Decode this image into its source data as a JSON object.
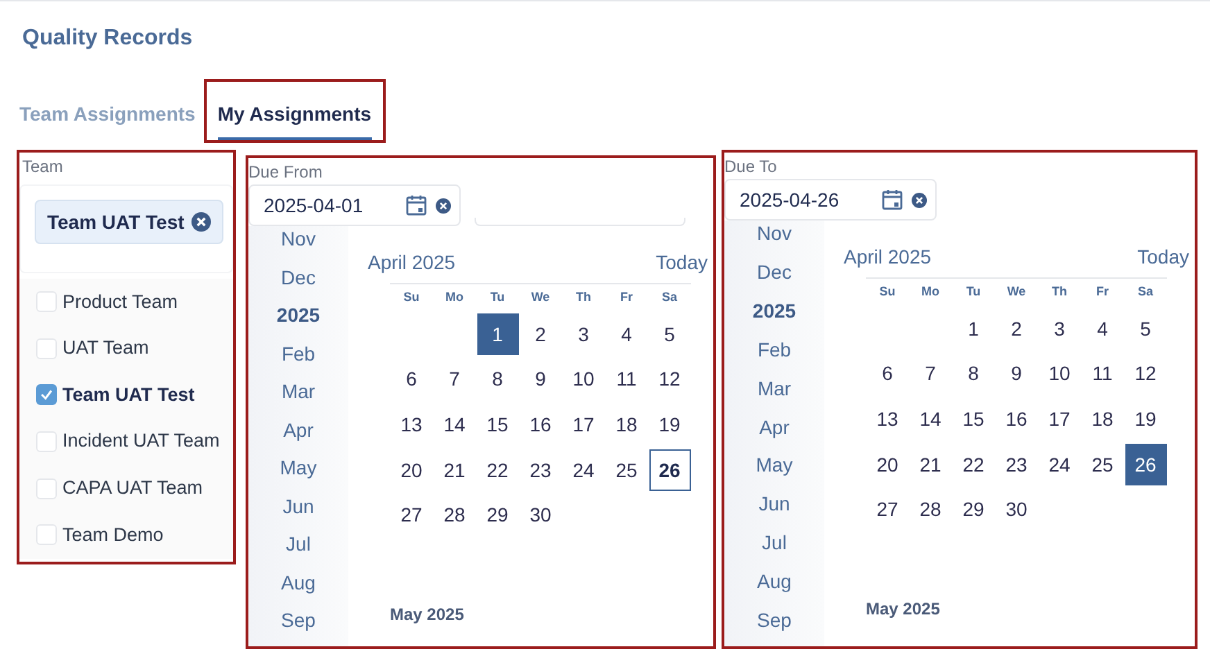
{
  "page_title": "Quality Records",
  "tabs": [
    {
      "label": "Team Assignments",
      "selected": false,
      "highlighted": false
    },
    {
      "label": "My Assignments",
      "selected": true,
      "highlighted": true
    }
  ],
  "team_filter": {
    "label": "Team",
    "highlighted": true,
    "chips": [
      "Team UAT Test"
    ],
    "options": [
      {
        "label": "Product Team",
        "checked": false
      },
      {
        "label": "UAT Team",
        "checked": false
      },
      {
        "label": "Team UAT Test",
        "checked": true
      },
      {
        "label": "Incident UAT Team",
        "checked": false
      },
      {
        "label": "CAPA UAT Team",
        "checked": false
      },
      {
        "label": "Team Demo",
        "checked": false
      }
    ]
  },
  "date_filters": [
    {
      "label": "Due From",
      "value": "2025-04-01",
      "highlighted": true,
      "extra_field": true,
      "calendar": {
        "months": [
          {
            "label": "Nov",
            "selected": false
          },
          {
            "label": "Dec",
            "selected": false
          },
          {
            "label": "2025",
            "selected": true
          },
          {
            "label": "Feb",
            "selected": false
          },
          {
            "label": "Mar",
            "selected": false
          },
          {
            "label": "Apr",
            "selected": false
          },
          {
            "label": "May",
            "selected": false
          },
          {
            "label": "Jun",
            "selected": false
          },
          {
            "label": "Jul",
            "selected": false
          },
          {
            "label": "Aug",
            "selected": false
          },
          {
            "label": "Sep",
            "selected": false
          }
        ],
        "title": "April 2025",
        "today_link": "Today",
        "weekdays": [
          "Su",
          "Mo",
          "Tu",
          "We",
          "Th",
          "Fr",
          "Sa"
        ],
        "weeks": [
          [
            {
              "kind": "blank"
            },
            {
              "kind": "blank"
            },
            {
              "kind": "day",
              "label": "1",
              "selected": true,
              "today": false
            },
            {
              "kind": "day",
              "label": "2",
              "selected": false,
              "today": false
            },
            {
              "kind": "day",
              "label": "3",
              "selected": false,
              "today": false
            },
            {
              "kind": "day",
              "label": "4",
              "selected": false,
              "today": false
            },
            {
              "kind": "day",
              "label": "5",
              "selected": false,
              "today": false
            }
          ],
          [
            {
              "kind": "day",
              "label": "6",
              "selected": false,
              "today": false
            },
            {
              "kind": "day",
              "label": "7",
              "selected": false,
              "today": false
            },
            {
              "kind": "day",
              "label": "8",
              "selected": false,
              "today": false
            },
            {
              "kind": "day",
              "label": "9",
              "selected": false,
              "today": false
            },
            {
              "kind": "day",
              "label": "10",
              "selected": false,
              "today": false
            },
            {
              "kind": "day",
              "label": "11",
              "selected": false,
              "today": false
            },
            {
              "kind": "day",
              "label": "12",
              "selected": false,
              "today": false
            }
          ],
          [
            {
              "kind": "day",
              "label": "13",
              "selected": false,
              "today": false
            },
            {
              "kind": "day",
              "label": "14",
              "selected": false,
              "today": false
            },
            {
              "kind": "day",
              "label": "15",
              "selected": false,
              "today": false
            },
            {
              "kind": "day",
              "label": "16",
              "selected": false,
              "today": false
            },
            {
              "kind": "day",
              "label": "17",
              "selected": false,
              "today": false
            },
            {
              "kind": "day",
              "label": "18",
              "selected": false,
              "today": false
            },
            {
              "kind": "day",
              "label": "19",
              "selected": false,
              "today": false
            }
          ],
          [
            {
              "kind": "day",
              "label": "20",
              "selected": false,
              "today": false
            },
            {
              "kind": "day",
              "label": "21",
              "selected": false,
              "today": false
            },
            {
              "kind": "day",
              "label": "22",
              "selected": false,
              "today": false
            },
            {
              "kind": "day",
              "label": "23",
              "selected": false,
              "today": false
            },
            {
              "kind": "day",
              "label": "24",
              "selected": false,
              "today": false
            },
            {
              "kind": "day",
              "label": "25",
              "selected": false,
              "today": false
            },
            {
              "kind": "day",
              "label": "26",
              "selected": false,
              "today": true
            }
          ],
          [
            {
              "kind": "day",
              "label": "27",
              "selected": false,
              "today": false
            },
            {
              "kind": "day",
              "label": "28",
              "selected": false,
              "today": false
            },
            {
              "kind": "day",
              "label": "29",
              "selected": false,
              "today": false
            },
            {
              "kind": "day",
              "label": "30",
              "selected": false,
              "today": false
            }
          ]
        ],
        "next_month": "May 2025"
      }
    },
    {
      "label": "Due To",
      "value": "2025-04-26",
      "highlighted": true,
      "extra_field": false,
      "calendar": {
        "months": [
          {
            "label": "Nov",
            "selected": false
          },
          {
            "label": "Dec",
            "selected": false
          },
          {
            "label": "2025",
            "selected": true
          },
          {
            "label": "Feb",
            "selected": false
          },
          {
            "label": "Mar",
            "selected": false
          },
          {
            "label": "Apr",
            "selected": false
          },
          {
            "label": "May",
            "selected": false
          },
          {
            "label": "Jun",
            "selected": false
          },
          {
            "label": "Jul",
            "selected": false
          },
          {
            "label": "Aug",
            "selected": false
          },
          {
            "label": "Sep",
            "selected": false
          }
        ],
        "title": "April 2025",
        "today_link": "Today",
        "weekdays": [
          "Su",
          "Mo",
          "Tu",
          "We",
          "Th",
          "Fr",
          "Sa"
        ],
        "weeks": [
          [
            {
              "kind": "blank"
            },
            {
              "kind": "blank"
            },
            {
              "kind": "day",
              "label": "1",
              "selected": false,
              "today": false
            },
            {
              "kind": "day",
              "label": "2",
              "selected": false,
              "today": false
            },
            {
              "kind": "day",
              "label": "3",
              "selected": false,
              "today": false
            },
            {
              "kind": "day",
              "label": "4",
              "selected": false,
              "today": false
            },
            {
              "kind": "day",
              "label": "5",
              "selected": false,
              "today": false
            }
          ],
          [
            {
              "kind": "day",
              "label": "6",
              "selected": false,
              "today": false
            },
            {
              "kind": "day",
              "label": "7",
              "selected": false,
              "today": false
            },
            {
              "kind": "day",
              "label": "8",
              "selected": false,
              "today": false
            },
            {
              "kind": "day",
              "label": "9",
              "selected": false,
              "today": false
            },
            {
              "kind": "day",
              "label": "10",
              "selected": false,
              "today": false
            },
            {
              "kind": "day",
              "label": "11",
              "selected": false,
              "today": false
            },
            {
              "kind": "day",
              "label": "12",
              "selected": false,
              "today": false
            }
          ],
          [
            {
              "kind": "day",
              "label": "13",
              "selected": false,
              "today": false
            },
            {
              "kind": "day",
              "label": "14",
              "selected": false,
              "today": false
            },
            {
              "kind": "day",
              "label": "15",
              "selected": false,
              "today": false
            },
            {
              "kind": "day",
              "label": "16",
              "selected": false,
              "today": false
            },
            {
              "kind": "day",
              "label": "17",
              "selected": false,
              "today": false
            },
            {
              "kind": "day",
              "label": "18",
              "selected": false,
              "today": false
            },
            {
              "kind": "day",
              "label": "19",
              "selected": false,
              "today": false
            }
          ],
          [
            {
              "kind": "day",
              "label": "20",
              "selected": false,
              "today": false
            },
            {
              "kind": "day",
              "label": "21",
              "selected": false,
              "today": false
            },
            {
              "kind": "day",
              "label": "22",
              "selected": false,
              "today": false
            },
            {
              "kind": "day",
              "label": "23",
              "selected": false,
              "today": false
            },
            {
              "kind": "day",
              "label": "24",
              "selected": false,
              "today": false
            },
            {
              "kind": "day",
              "label": "25",
              "selected": false,
              "today": false
            },
            {
              "kind": "day",
              "label": "26",
              "selected": true,
              "today": false
            }
          ],
          [
            {
              "kind": "day",
              "label": "27",
              "selected": false,
              "today": false
            },
            {
              "kind": "day",
              "label": "28",
              "selected": false,
              "today": false
            },
            {
              "kind": "day",
              "label": "29",
              "selected": false,
              "today": false
            },
            {
              "kind": "day",
              "label": "30",
              "selected": false,
              "today": false
            }
          ]
        ],
        "next_month": "May 2025"
      }
    }
  ]
}
